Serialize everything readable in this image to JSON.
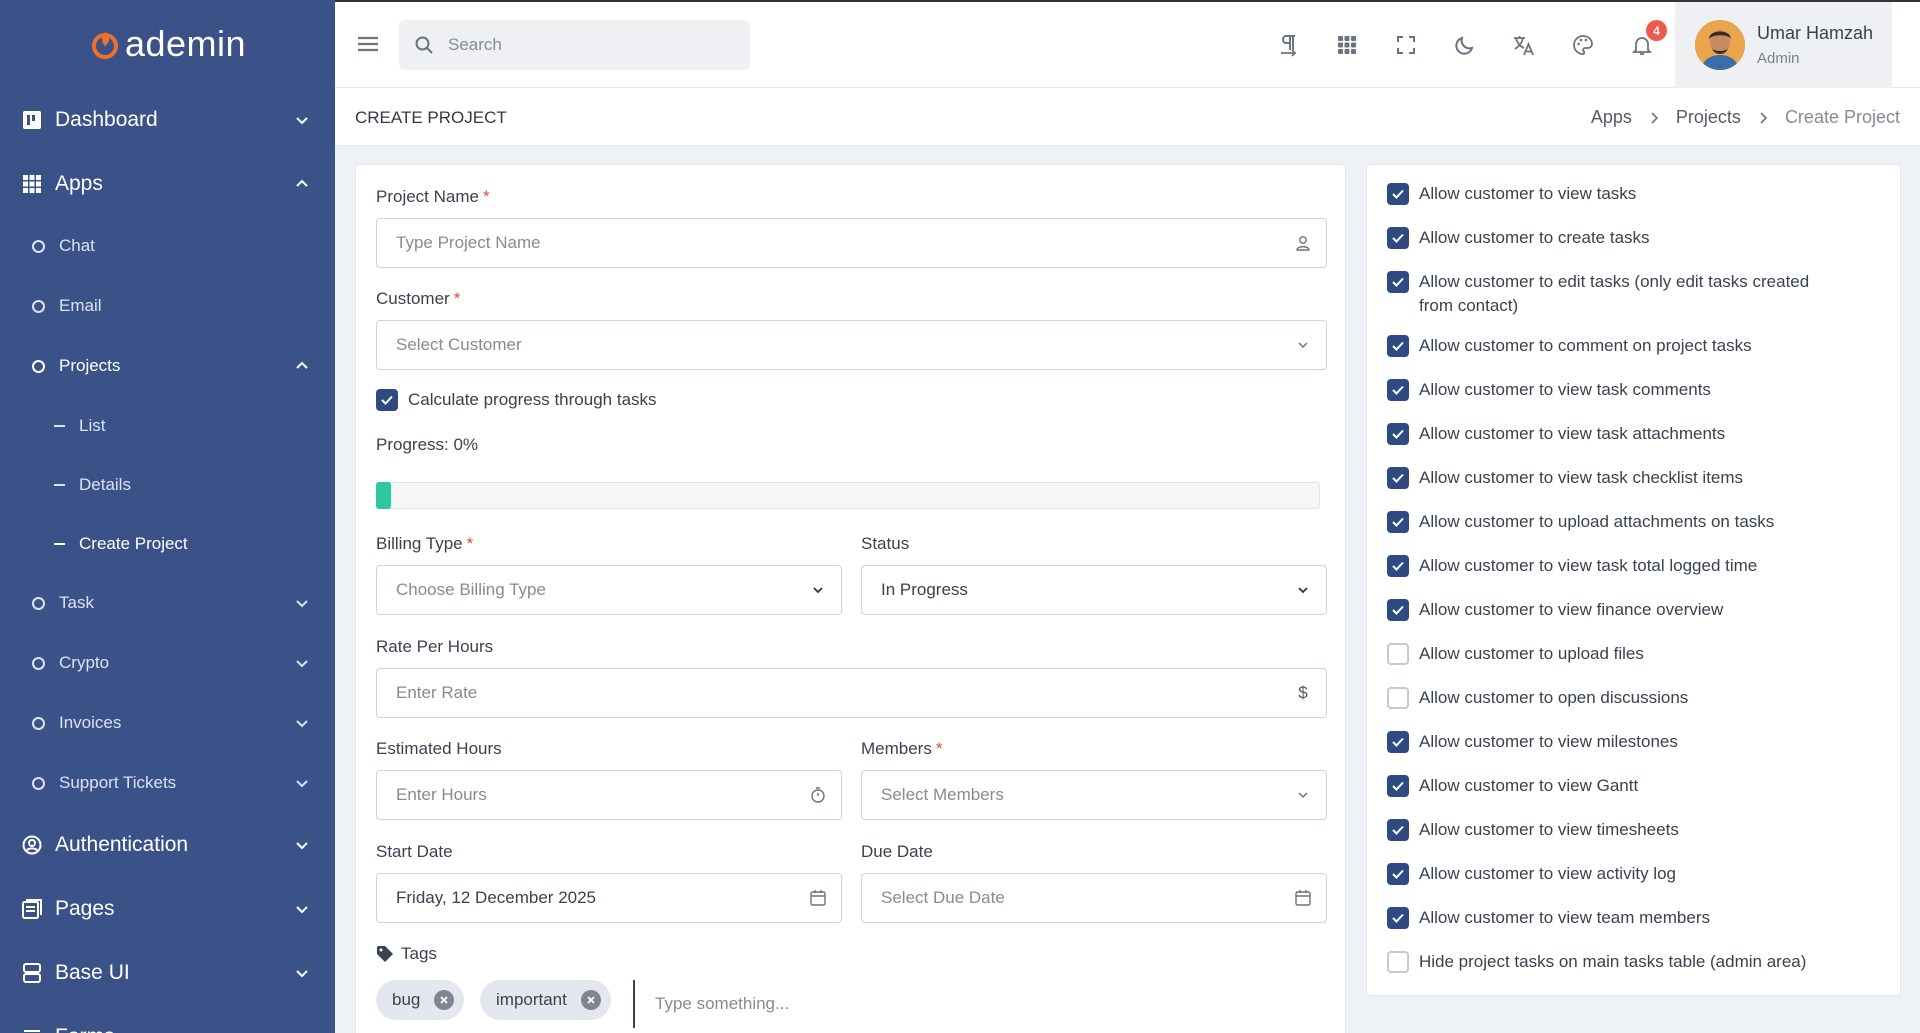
{
  "brand": {
    "name": "ademin",
    "accent": "#f0702a",
    "sidebar_bg": "#3a5288",
    "primary": "#2f4a80",
    "progress_color": "#2fc7a0"
  },
  "sidebar": {
    "items": [
      {
        "label": "Dashboard",
        "icon": "dashboard-icon"
      },
      {
        "label": "Apps",
        "icon": "apps-grid-icon"
      },
      {
        "label": "Chat"
      },
      {
        "label": "Email"
      },
      {
        "label": "Projects"
      },
      {
        "label": "List"
      },
      {
        "label": "Details"
      },
      {
        "label": "Create Project"
      },
      {
        "label": "Task"
      },
      {
        "label": "Crypto"
      },
      {
        "label": "Invoices"
      },
      {
        "label": "Support Tickets"
      },
      {
        "label": "Authentication",
        "icon": "user-circle-icon"
      },
      {
        "label": "Pages",
        "icon": "pages-icon"
      },
      {
        "label": "Base UI",
        "icon": "base-ui-icon"
      },
      {
        "label": "Forms",
        "icon": "forms-icon"
      }
    ]
  },
  "topbar": {
    "search_placeholder": "Search",
    "notification_count": "4",
    "user": {
      "name": "Umar Hamzah",
      "role": "Admin"
    }
  },
  "page": {
    "title": "CREATE PROJECT",
    "breadcrumb": [
      "Apps",
      "Projects",
      "Create Project"
    ]
  },
  "form": {
    "project_name": {
      "label": "Project Name",
      "placeholder": "Type Project Name"
    },
    "customer": {
      "label": "Customer",
      "placeholder": "Select Customer"
    },
    "calc_progress": {
      "label": "Calculate progress through tasks",
      "checked": true
    },
    "progress": {
      "label": "Progress: 0%",
      "value_percent": 0
    },
    "billing_type": {
      "label": "Billing Type",
      "placeholder": "Choose Billing Type"
    },
    "status": {
      "label": "Status",
      "value": "In Progress"
    },
    "rate": {
      "label": "Rate Per Hours",
      "placeholder": "Enter Rate"
    },
    "estimated_hours": {
      "label": "Estimated Hours",
      "placeholder": "Enter Hours"
    },
    "members": {
      "label": "Members",
      "placeholder": "Select Members"
    },
    "start_date": {
      "label": "Start Date",
      "value": "Friday, 12 December 2025"
    },
    "due_date": {
      "label": "Due Date",
      "placeholder": "Select Due Date"
    },
    "tags": {
      "label": "Tags",
      "items": [
        "bug",
        "important"
      ],
      "placeholder": "Type something..."
    }
  },
  "permissions": [
    {
      "label": "Allow customer to view tasks",
      "checked": true
    },
    {
      "label": "Allow customer to create tasks",
      "checked": true
    },
    {
      "label": "Allow customer to edit tasks (only edit tasks created",
      "label2": "from contact)",
      "checked": true
    },
    {
      "label": "Allow customer to comment on project tasks",
      "checked": true
    },
    {
      "label": "Allow customer to view task comments",
      "checked": true
    },
    {
      "label": "Allow customer to view task attachments",
      "checked": true
    },
    {
      "label": "Allow customer to view task checklist items",
      "checked": true
    },
    {
      "label": "Allow customer to upload attachments on tasks",
      "checked": true
    },
    {
      "label": "Allow customer to view task total logged time",
      "checked": true
    },
    {
      "label": "Allow customer to view finance overview",
      "checked": true
    },
    {
      "label": "Allow customer to upload files",
      "checked": false
    },
    {
      "label": "Allow customer to open discussions",
      "checked": false
    },
    {
      "label": "Allow customer to view milestones",
      "checked": true
    },
    {
      "label": "Allow customer to view Gantt",
      "checked": true
    },
    {
      "label": "Allow customer to view timesheets",
      "checked": true
    },
    {
      "label": "Allow customer to view activity log",
      "checked": true
    },
    {
      "label": "Allow customer to view team members",
      "checked": true
    },
    {
      "label": "Hide project tasks on main tasks table (admin area)",
      "checked": false
    }
  ]
}
